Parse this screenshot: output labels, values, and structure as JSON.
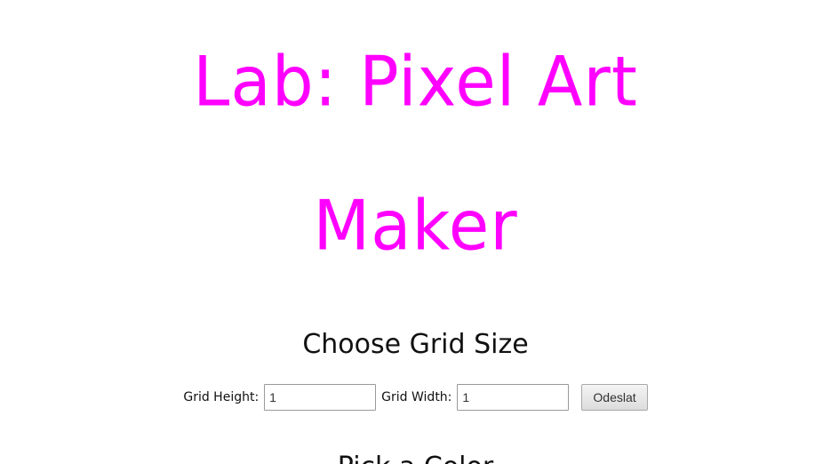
{
  "header": {
    "title_line1": "Lab: Pixel Art",
    "title_line2": "Maker"
  },
  "grid_size": {
    "heading": "Choose Grid Size",
    "height_label": "Grid Height:",
    "height_value": "1",
    "width_label": "Grid Width:",
    "width_value": "1",
    "submit_label": "Odeslat"
  },
  "next_section": {
    "heading": "Pick a Color"
  },
  "colors": {
    "title": "#ff00ff",
    "text": "#111111"
  }
}
